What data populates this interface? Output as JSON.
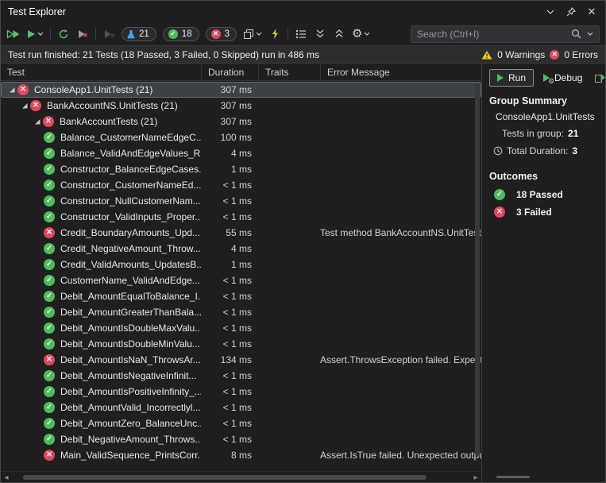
{
  "window": {
    "title": "Test Explorer"
  },
  "toolbar": {
    "badges": {
      "total": "21",
      "passed": "18",
      "failed": "3"
    },
    "search_placeholder": "Search (Ctrl+I)"
  },
  "infobar": {
    "message": "Test run finished: 21 Tests (18 Passed, 3 Failed, 0 Skipped) run in 486 ms",
    "warnings": "0 Warnings",
    "errors": "0 Errors"
  },
  "table": {
    "columns": [
      "Test",
      "Duration",
      "Traits",
      "Error Message"
    ],
    "rows": [
      {
        "level": 0,
        "group": true,
        "status": "failed",
        "name": "ConsoleApp1.UnitTests (21)",
        "duration": "307 ms",
        "error": "",
        "selected": true
      },
      {
        "level": 1,
        "group": true,
        "status": "failed",
        "name": "BankAccountNS.UnitTests (21)",
        "duration": "307 ms",
        "error": ""
      },
      {
        "level": 2,
        "group": true,
        "status": "failed",
        "name": "BankAccountTests (21)",
        "duration": "307 ms",
        "error": ""
      },
      {
        "level": 3,
        "status": "passed",
        "name": "Balance_CustomerNameEdgeC...",
        "duration": "100 ms",
        "error": ""
      },
      {
        "level": 3,
        "status": "passed",
        "name": "Balance_ValidAndEdgeValues_R...",
        "duration": "4 ms",
        "error": ""
      },
      {
        "level": 3,
        "status": "passed",
        "name": "Constructor_BalanceEdgeCases...",
        "duration": "1 ms",
        "error": ""
      },
      {
        "level": 3,
        "status": "passed",
        "name": "Constructor_CustomerNameEd...",
        "duration": "< 1 ms",
        "error": ""
      },
      {
        "level": 3,
        "status": "passed",
        "name": "Constructor_NullCustomerNam...",
        "duration": "< 1 ms",
        "error": ""
      },
      {
        "level": 3,
        "status": "passed",
        "name": "Constructor_ValidInputs_Proper...",
        "duration": "< 1 ms",
        "error": ""
      },
      {
        "level": 3,
        "status": "failed",
        "name": "Credit_BoundaryAmounts_Upd...",
        "duration": "55 ms",
        "error": "Test method BankAccountNS.UnitTest"
      },
      {
        "level": 3,
        "status": "passed",
        "name": "Credit_NegativeAmount_Throw...",
        "duration": "4 ms",
        "error": ""
      },
      {
        "level": 3,
        "status": "passed",
        "name": "Credit_ValidAmounts_UpdatesB...",
        "duration": "1 ms",
        "error": ""
      },
      {
        "level": 3,
        "status": "passed",
        "name": "CustomerName_ValidAndEdge...",
        "duration": "< 1 ms",
        "error": ""
      },
      {
        "level": 3,
        "status": "passed",
        "name": "Debit_AmountEqualToBalance_I...",
        "duration": "< 1 ms",
        "error": ""
      },
      {
        "level": 3,
        "status": "passed",
        "name": "Debit_AmountGreaterThanBala...",
        "duration": "< 1 ms",
        "error": ""
      },
      {
        "level": 3,
        "status": "passed",
        "name": "Debit_AmountIsDoubleMaxValu...",
        "duration": "< 1 ms",
        "error": ""
      },
      {
        "level": 3,
        "status": "passed",
        "name": "Debit_AmountIsDoubleMinValu...",
        "duration": "< 1 ms",
        "error": ""
      },
      {
        "level": 3,
        "status": "failed",
        "name": "Debit_AmountIsNaN_ThrowsAr...",
        "duration": "134 ms",
        "error": "Assert.ThrowsException failed. Expect"
      },
      {
        "level": 3,
        "status": "passed",
        "name": "Debit_AmountIsNegativeInfinit...",
        "duration": "< 1 ms",
        "error": ""
      },
      {
        "level": 3,
        "status": "passed",
        "name": "Debit_AmountIsPositiveInfinity_...",
        "duration": "< 1 ms",
        "error": ""
      },
      {
        "level": 3,
        "status": "passed",
        "name": "Debit_AmountValid_Incorrectlyl...",
        "duration": "< 1 ms",
        "error": ""
      },
      {
        "level": 3,
        "status": "passed",
        "name": "Debit_AmountZero_BalanceUnc...",
        "duration": "< 1 ms",
        "error": ""
      },
      {
        "level": 3,
        "status": "passed",
        "name": "Debit_NegativeAmount_Throws...",
        "duration": "< 1 ms",
        "error": ""
      },
      {
        "level": 3,
        "status": "failed",
        "name": "Main_ValidSequence_PrintsCorr...",
        "duration": "8 ms",
        "error": "Assert.IsTrue failed. Unexpected outpu"
      }
    ]
  },
  "side": {
    "run_label": "Run",
    "debug_label": "Debug",
    "group_summary_title": "Group Summary",
    "group_name": "ConsoleApp1.UnitTests",
    "tests_in_group_label": "Tests in group:",
    "tests_in_group_value": "21",
    "total_duration_label": "Total Duration:",
    "total_duration_value": "3",
    "outcomes_title": "Outcomes",
    "passed_label": "18 Passed",
    "failed_label": "3 Failed"
  },
  "colors": {
    "passed-green": "#53b961",
    "failed-red": "#e8445f",
    "warning-yellow": "#f2cc0c",
    "accent-blue": "#4ba0e8",
    "lightning-yellow": "#d9c64a"
  }
}
